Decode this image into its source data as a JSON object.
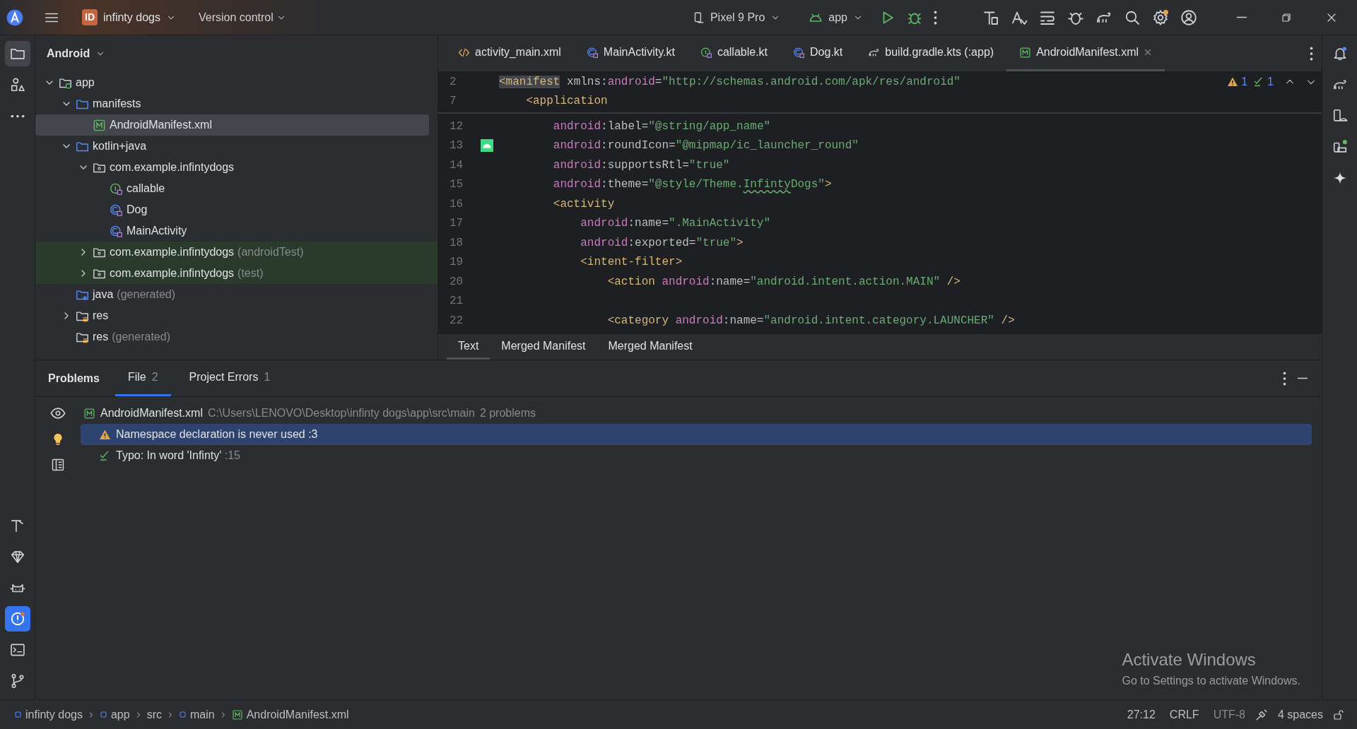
{
  "title_bar": {
    "project_badge": "ID",
    "project": "infinty dogs",
    "vcs": "Version control",
    "device": "Pixel 9 Pro",
    "run_config": "app"
  },
  "project_panel": {
    "view": "Android",
    "tree": [
      {
        "label": "app",
        "kind": "module",
        "expanded": true,
        "selected": false,
        "test_scope": false,
        "children": [
          {
            "label": "manifests",
            "kind": "folder",
            "expanded": true,
            "selected": false,
            "test_scope": false,
            "children": [
              {
                "label": "AndroidManifest.xml",
                "kind": "manifest",
                "selected": true,
                "test_scope": false
              }
            ]
          },
          {
            "label": "kotlin+java",
            "kind": "folder",
            "expanded": true,
            "selected": false,
            "test_scope": false,
            "children": [
              {
                "label": "com.example.infintydogs",
                "kind": "package",
                "expanded": true,
                "selected": false,
                "test_scope": false,
                "children": [
                  {
                    "label": "callable",
                    "kind": "interface",
                    "selected": false,
                    "test_scope": false
                  },
                  {
                    "label": "Dog",
                    "kind": "class",
                    "selected": false,
                    "test_scope": false
                  },
                  {
                    "label": "MainActivity",
                    "kind": "class",
                    "selected": false,
                    "test_scope": false
                  }
                ]
              },
              {
                "label": "com.example.infintydogs",
                "hint": "(androidTest)",
                "kind": "package",
                "expanded": false,
                "selected": false,
                "test_scope": true
              },
              {
                "label": "com.example.infintydogs",
                "hint": "(test)",
                "kind": "package",
                "expanded": false,
                "selected": false,
                "test_scope": true
              }
            ]
          },
          {
            "label": "java",
            "hint": "(generated)",
            "kind": "generated",
            "selected": false,
            "test_scope": false
          },
          {
            "label": "res",
            "kind": "res",
            "expanded": false,
            "selected": false,
            "test_scope": false
          },
          {
            "label": "res",
            "hint": "(generated)",
            "kind": "res",
            "selected": false,
            "test_scope": false
          }
        ]
      }
    ]
  },
  "editor": {
    "tabs": [
      {
        "label": "activity_main.xml",
        "kind": "layout",
        "selected": false
      },
      {
        "label": "MainActivity.kt",
        "kind": "class",
        "selected": false
      },
      {
        "label": "callable.kt",
        "kind": "interface",
        "selected": false
      },
      {
        "label": "Dog.kt",
        "kind": "class",
        "selected": false
      },
      {
        "label": "build.gradle.kts (:app)",
        "kind": "gradle",
        "selected": false
      },
      {
        "label": "AndroidManifest.xml",
        "kind": "manifest",
        "selected": true
      }
    ],
    "inspections": {
      "warnings": "1",
      "typos": "1"
    },
    "sticky_lines": [
      {
        "number": "2",
        "tokens": [
          {
            "tag": "<manifest",
            "matched": true
          },
          {
            "plain": " xmlns:"
          },
          {
            "ns": "android"
          },
          {
            "plain": "="
          },
          {
            "str": "\"http://schemas.android.com/apk/res/android\""
          }
        ]
      },
      {
        "number": "7",
        "tokens": [
          {
            "tag": "    <application"
          }
        ]
      }
    ],
    "lines": [
      {
        "number": "12",
        "tokens": [
          {
            "ns": "        android"
          },
          {
            "plain": ":label="
          },
          {
            "str": "\"@string/app_name\""
          }
        ]
      },
      {
        "number": "13",
        "gutter_icon": true,
        "tokens": [
          {
            "ns": "        android"
          },
          {
            "plain": ":roundIcon="
          },
          {
            "str": "\"@mipmap/ic_launcher_round\""
          }
        ]
      },
      {
        "number": "14",
        "tokens": [
          {
            "ns": "        android"
          },
          {
            "plain": ":supportsRtl="
          },
          {
            "str": "\"true\""
          }
        ]
      },
      {
        "number": "15",
        "tokens": [
          {
            "ns": "        android"
          },
          {
            "plain": ":theme="
          },
          {
            "str": "\"@style/Theme."
          },
          {
            "typo": "Infinty"
          },
          {
            "str": "Dogs\""
          },
          {
            "tag": ">"
          }
        ]
      },
      {
        "number": "16",
        "tokens": [
          {
            "tag": "        <activity"
          }
        ]
      },
      {
        "number": "17",
        "tokens": [
          {
            "ns": "            android"
          },
          {
            "plain": ":name="
          },
          {
            "str": "\".MainActivity\""
          }
        ]
      },
      {
        "number": "18",
        "tokens": [
          {
            "ns": "            android"
          },
          {
            "plain": ":exported="
          },
          {
            "str": "\"true\""
          },
          {
            "tag": ">"
          }
        ]
      },
      {
        "number": "19",
        "tokens": [
          {
            "tag": "            <intent-filter>"
          }
        ]
      },
      {
        "number": "20",
        "tokens": [
          {
            "tag": "                <action "
          },
          {
            "ns": "android"
          },
          {
            "plain": ":name="
          },
          {
            "str": "\"android.intent.action.MAIN\""
          },
          {
            "tag": " />"
          }
        ]
      },
      {
        "number": "21"
      },
      {
        "number": "22",
        "tokens": [
          {
            "tag": "                <category "
          },
          {
            "ns": "android"
          },
          {
            "plain": ":name="
          },
          {
            "str": "\"android.intent.category.LAUNCHER\""
          },
          {
            "tag": " />"
          }
        ]
      }
    ],
    "bottom_tabs": [
      {
        "label": "Text",
        "selected": true
      },
      {
        "label": "Merged Manifest",
        "selected": false
      },
      {
        "label": "Merged Manifest",
        "selected": false
      }
    ]
  },
  "problems": {
    "title": "Problems",
    "tabs": [
      {
        "label": "File",
        "count": "2",
        "selected": true
      },
      {
        "label": "Project Errors",
        "count": "1",
        "selected": false
      }
    ],
    "file": {
      "name": "AndroidManifest.xml",
      "path": "C:\\Users\\LENOVO\\Desktop\\infinty dogs\\app\\src\\main",
      "summary": "2 problems"
    },
    "items": [
      {
        "kind": "warning",
        "text": "Namespace declaration is never used",
        "location": ":3",
        "selected": true
      },
      {
        "kind": "typo",
        "text": "Typo: In word 'Infinty'",
        "location": ":15",
        "selected": false
      }
    ]
  },
  "activation": {
    "title": "Activate Windows",
    "hint": "Go to Settings to activate Windows."
  },
  "status_bar": {
    "breadcrumbs": [
      {
        "label": "infinty dogs",
        "kind": "module"
      },
      {
        "label": "app",
        "kind": "module"
      },
      {
        "label": "src",
        "kind": "plain"
      },
      {
        "label": "main",
        "kind": "module"
      },
      {
        "label": "AndroidManifest.xml",
        "kind": "manifest"
      }
    ],
    "position": "27:12",
    "line_ending": "CRLF",
    "encoding": "UTF-8",
    "indent": "4 spaces"
  }
}
